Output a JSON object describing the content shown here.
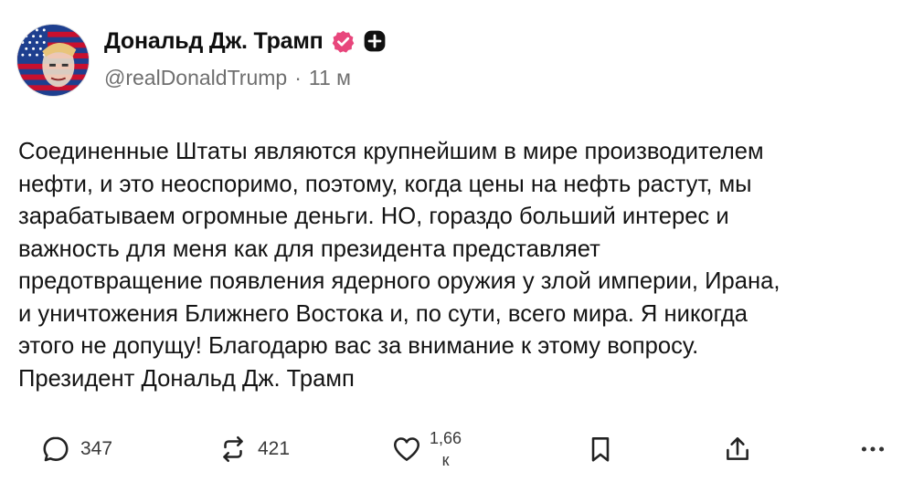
{
  "post": {
    "author": {
      "display_name": "Дональд Дж. Трамп",
      "handle": "@realDonaldTrump",
      "separator": "·",
      "time_ago": "11 м",
      "verified_icon": "verified-check-icon",
      "badge_icon": "plus-badge-icon",
      "verified_color": "#e8467c"
    },
    "body": {
      "lines": [
        "Соединенные Штаты являются крупнейшим в мире производителем",
        "нефти, и это неоспоримо, поэтому, когда цены на нефть растут, мы",
        "зарабатываем огромные деньги. НО, гораздо больший интерес и",
        "важность для меня как для президента представляет",
        "предотвращение появления ядерного оружия у злой империи, Ирана,",
        "и уничтожения Ближнего Востока и, по сути, всего мира. Я никогда",
        "этого не допущу! Благодарю вас за внимание к этому вопросу.",
        "Президент Дональд Дж. Трамп"
      ]
    },
    "actions": {
      "reply": {
        "icon": "reply-bubble-icon",
        "count": "347"
      },
      "repost": {
        "icon": "repost-arrows-icon",
        "count": "421"
      },
      "like": {
        "icon": "heart-icon",
        "count_top": "1,66",
        "count_bottom": "к"
      },
      "bookmark": {
        "icon": "bookmark-icon"
      },
      "share": {
        "icon": "share-upload-icon"
      },
      "more": {
        "icon": "more-dots-icon"
      }
    }
  }
}
